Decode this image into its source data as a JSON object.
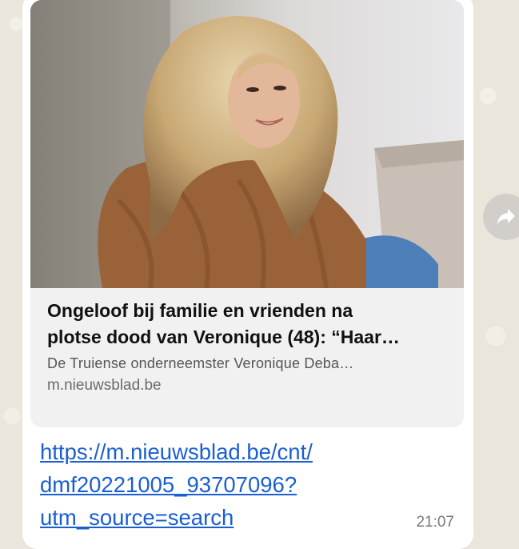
{
  "link_preview": {
    "title_line1": "Ongeloof bij familie en vrienden na",
    "title_line2": "plotse dood van Veronique (48): “Haar…",
    "description": "De Truiense onderneemster Veronique Deba…",
    "domain": "m.nieuwsblad.be"
  },
  "message": {
    "link_line1": "https://m.nieuwsblad.be/cnt/",
    "link_line2": "dmf20221005_93707096?",
    "link_line3": "utm_source=search",
    "time": "21:07"
  },
  "icons": {
    "forward": "forward-arrow-icon"
  },
  "colors": {
    "link": "#1a5fd0",
    "bubble": "#ffffff",
    "preview_background": "#f1f1f2",
    "wallpaper": "#ebe6dc"
  }
}
